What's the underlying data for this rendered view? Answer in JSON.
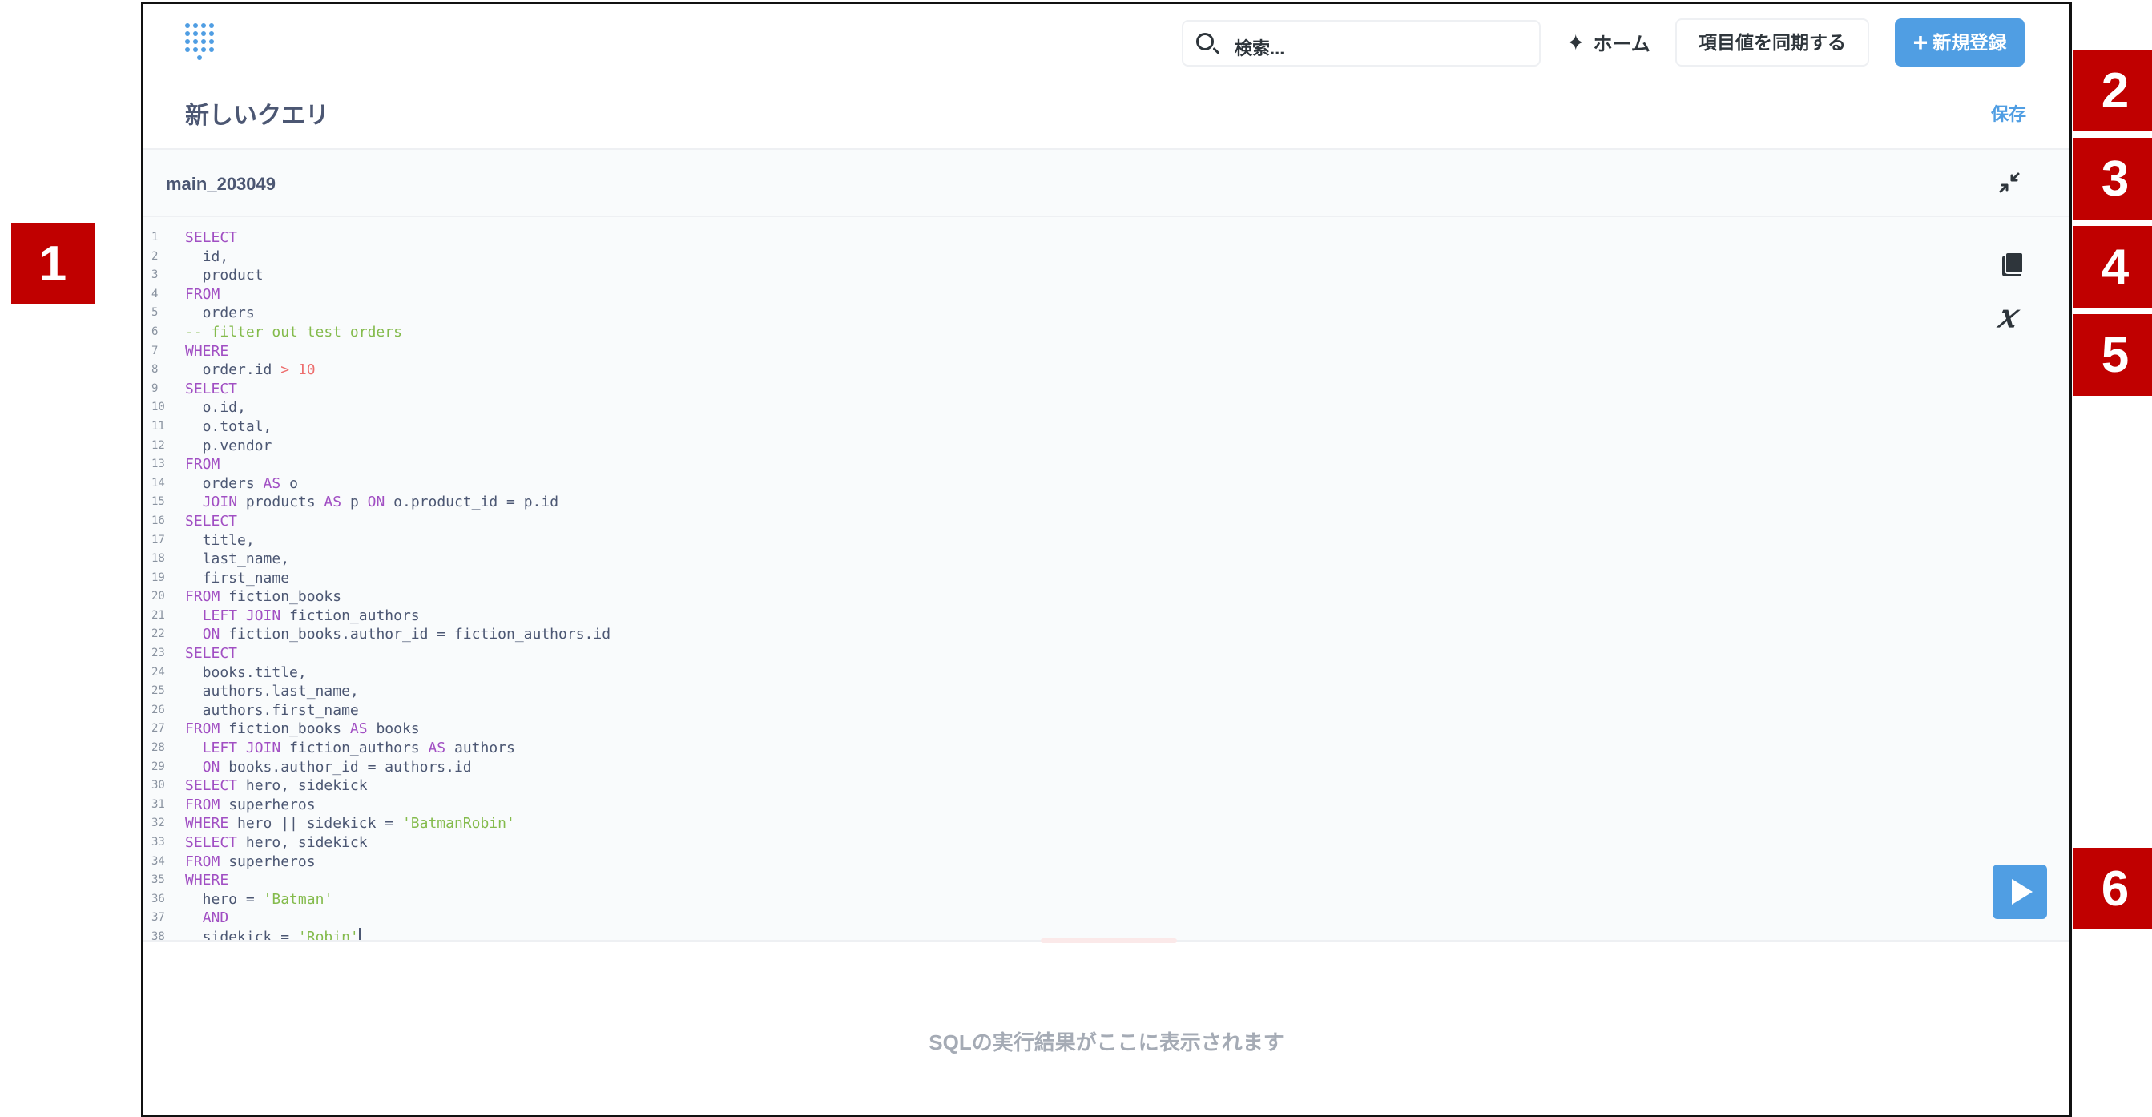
{
  "header": {
    "search_placeholder": "検索...",
    "home_label": "ホーム",
    "sync_label": "項目値を同期する",
    "new_label": "新規登録"
  },
  "query": {
    "title": "新しいクエリ",
    "save_label": "保存",
    "database_name": "main_203049"
  },
  "editor": {
    "line_numbers": [
      "1",
      "2",
      "3",
      "4",
      "5",
      "6",
      "7",
      "8",
      "9",
      "10",
      "11",
      "12",
      "13",
      "14",
      "15",
      "16",
      "17",
      "18",
      "19",
      "20",
      "21",
      "22",
      "23",
      "24",
      "25",
      "26",
      "27",
      "28",
      "29",
      "30",
      "31",
      "32",
      "33",
      "34",
      "35",
      "36",
      "37",
      "38"
    ],
    "lines": [
      "SELECT",
      "  id,",
      "  product",
      "FROM",
      "  orders",
      "-- filter out test orders",
      "WHERE",
      "  order.id > 10",
      "SELECT",
      "  o.id,",
      "  o.total,",
      "  p.vendor",
      "FROM",
      "  orders AS o",
      "  JOIN products AS p ON o.product_id = p.id",
      "SELECT",
      "  title,",
      "  last_name,",
      "  first_name",
      "FROM fiction_books",
      "  LEFT JOIN fiction_authors",
      "  ON fiction_books.author_id = fiction_authors.id",
      "SELECT",
      "  books.title,",
      "  authors.last_name,",
      "  authors.first_name",
      "FROM fiction_books AS books",
      "  LEFT JOIN fiction_authors AS authors",
      "  ON books.author_id = authors.id",
      "SELECT hero, sidekick",
      "FROM superheros",
      "WHERE hero || sidekick = 'BatmanRobin'",
      "SELECT hero, sidekick",
      "FROM superheros",
      "WHERE",
      "  hero = 'Batman'",
      "  AND",
      "  sidekick = 'Robin'"
    ]
  },
  "results": {
    "empty_message": "SQLの実行結果がここに表示されます"
  },
  "callouts": [
    "1",
    "2",
    "3",
    "4",
    "5",
    "6"
  ],
  "colors": {
    "accent": "#509ee3",
    "keyword": "#a14fc3",
    "number": "#ed6e6e",
    "string": "#84bb4c",
    "callout": "#c00000"
  },
  "icons": {
    "logo": "metabase-logo-icon",
    "search": "search-icon",
    "home": "sparkle-icon",
    "new": "plus-icon",
    "collapse": "collapse-icon",
    "reference": "book-icon",
    "variables": "variable-x-icon",
    "run": "play-icon"
  }
}
